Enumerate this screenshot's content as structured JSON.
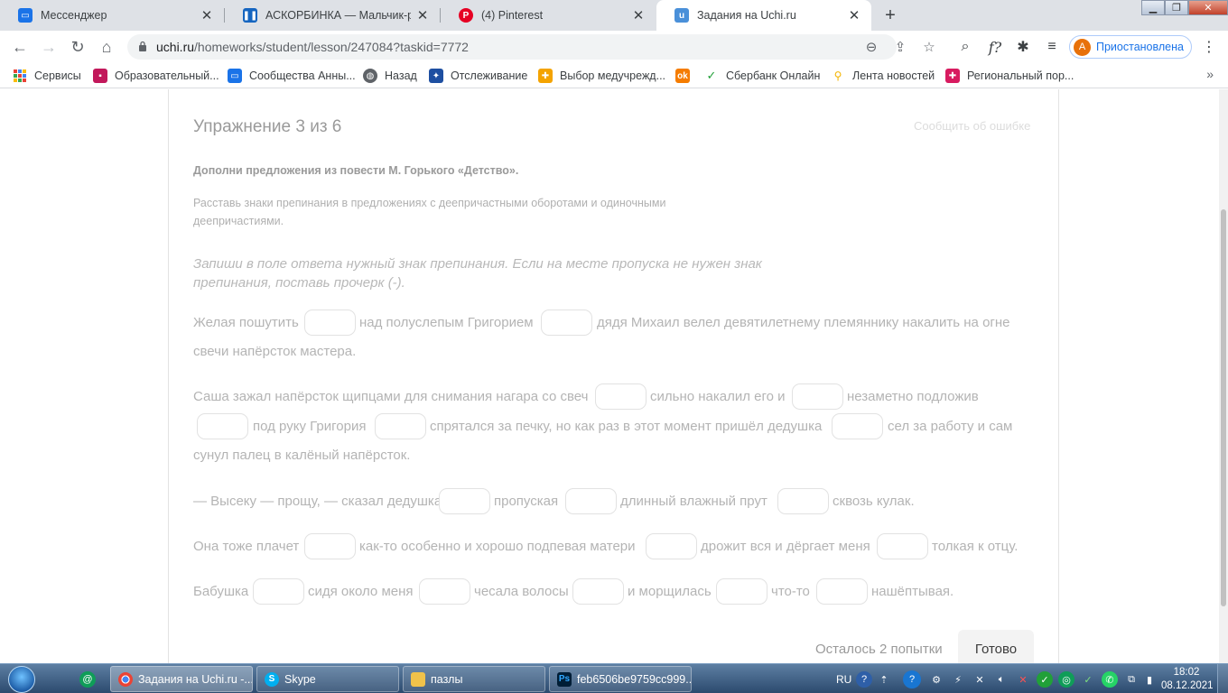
{
  "browser": {
    "tabs": [
      {
        "title": "Мессенджер",
        "icon": "messenger-icon",
        "color": "#1a73e8"
      },
      {
        "title": "АСКОРБИНКА — Мальчик-рома",
        "icon": "pause-icon",
        "color": "#1565c0"
      },
      {
        "title": "(4) Pinterest",
        "icon": "pinterest-icon",
        "color": "#e60023"
      },
      {
        "title": "Задания на Uchi.ru",
        "icon": "uchi-icon",
        "color": "#4a90d9",
        "active": true
      }
    ],
    "url_host": "uchi.ru",
    "url_path": "/homeworks/student/lesson/247084?taskid=7772",
    "profile": {
      "initial": "A",
      "status": "Приостановлена"
    },
    "bookmarks": [
      {
        "label": "Сервисы",
        "icon": "apps-grid-icon",
        "color": "#ea4335"
      },
      {
        "label": "Образовательный...",
        "icon": "education-icon",
        "color": "#c2185b"
      },
      {
        "label": "Сообщества Анны...",
        "icon": "community-icon",
        "color": "#1a73e8"
      },
      {
        "label": "Назад",
        "icon": "globe-icon",
        "color": "#5f6368"
      },
      {
        "label": "Отслеживание",
        "icon": "emblem-icon",
        "color": "#1e4fa1"
      },
      {
        "label": "Выбор медучрежд...",
        "icon": "medical-icon",
        "color": "#f4a300"
      },
      {
        "label": "",
        "icon": "odnoklassniki-icon",
        "color": "#f57c00"
      },
      {
        "label": "Сбербанк Онлайн",
        "icon": "sberbank-icon",
        "color": "#21a038"
      },
      {
        "label": "Лента новостей",
        "icon": "news-icon",
        "color": "#f4b400"
      },
      {
        "label": "Региональный пор...",
        "icon": "regional-portal-icon",
        "color": "#d81b60"
      }
    ]
  },
  "exercise": {
    "title": "Упражнение 3 из 6",
    "report_link": "Сообщить об ошибке",
    "task": "Дополни предложения из повести М. Горького «Детство».",
    "rule_line1": "Расставь знаки препинания в предложениях с деепричастными оборотами и одиночными",
    "rule_line2": "деепричастиями.",
    "instruction_line1": "Запиши в поле ответа нужный знак препинания. Если на месте пропуска не нужен знак",
    "instruction_line2": "препинания, поставь прочерк (-).",
    "s1": [
      "Желая пошутить",
      "над полуслепым Григорием",
      "дядя Михаил велел девятилетнему племяннику накалить на огне",
      "свечи напёрсток мастера."
    ],
    "s2": [
      "Саша зажал напёрсток щипцами для снимания нагара со свеч",
      "сильно накалил его и",
      "незаметно подложив",
      "под руку Григория",
      "спрятался за печку, но как раз в этот момент пришёл дедушка",
      "сел за работу и сам",
      "сунул палец в калёный напёрсток."
    ],
    "s3": [
      "— Высеку — прощу, — сказал дедушка",
      "пропуская",
      "длинный влажный прут",
      "сквозь кулак."
    ],
    "s4": [
      "Она тоже плачет",
      "как-то особенно и хорошо подпевая матери",
      "дрожит вся и дёргает меня",
      "толкая к отцу."
    ],
    "s5": [
      "Бабушка",
      "сидя около меня",
      "чесала волосы",
      "и морщилась",
      "что-то",
      "нашёптывая."
    ],
    "attempts": "Осталось 2 попытки",
    "done": "Готово"
  },
  "taskbar": {
    "items": [
      {
        "label": "Задания на Uchi.ru -...",
        "icon": "chrome-icon",
        "active": true
      },
      {
        "label": "Skype",
        "icon": "skype-icon"
      },
      {
        "label": "пазлы",
        "icon": "folder-icon"
      },
      {
        "label": "feb6506be9759cc999...",
        "icon": "photoshop-icon"
      }
    ],
    "lang": "RU",
    "time": "18:02",
    "date": "08.12.2021"
  }
}
